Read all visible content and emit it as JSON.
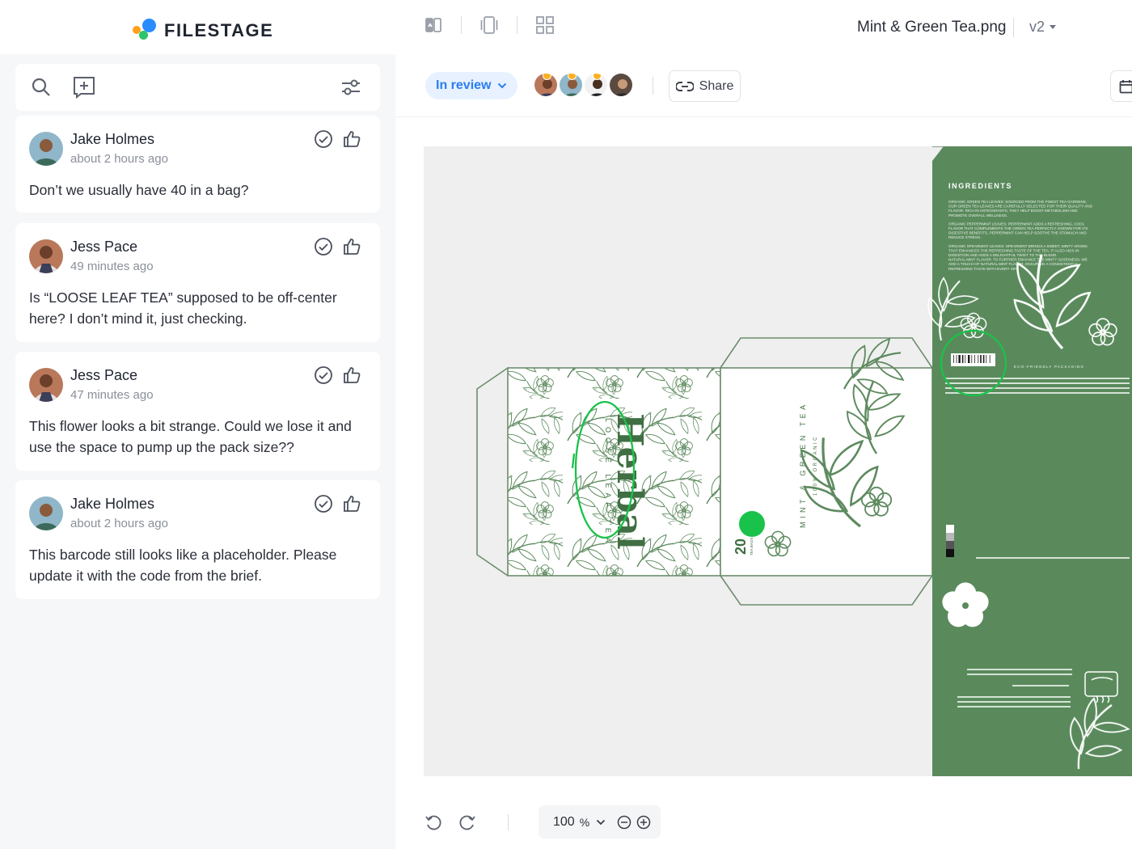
{
  "app": {
    "brand": "FILESTAGE",
    "file_title": "Mint & Green Tea.png",
    "version": "v2"
  },
  "colors": {
    "accent": "#2a7ef0",
    "status_bg": "#e7f1ff",
    "annotation_green": "#19c24a",
    "package_green": "#5a8a5c"
  },
  "review": {
    "status": "In review",
    "share_label": "Share"
  },
  "comments": [
    {
      "author": "Jake Holmes",
      "time": "about 2 hours ago",
      "text": "Don’t we usually have 40 in a bag?"
    },
    {
      "author": "Jess Pace",
      "time": "49 minutes ago",
      "text": "Is “LOOSE LEAF TEA” supposed to be off-center here? I don’t mind it, just checking."
    },
    {
      "author": "Jess Pace",
      "time": "47 minutes ago",
      "text": "This flower looks a bit strange. Could we lose it and use the space to pump up the pack size??"
    },
    {
      "author": "Jake Holmes",
      "time": "about 2 hours ago",
      "text": "This barcode still looks like a placeholder. Please update it with the code from the brief."
    }
  ],
  "artwork": {
    "brand_word": "Herbal",
    "subtitle": "LOOSE LEAF TEA",
    "side_title": "MINT & GREEN TEA",
    "side_sub": "100% ORGANIC",
    "count": "20",
    "count_unit": "TEA BAGS",
    "ingredients_heading": "INGREDIENTS",
    "ingredients_lines": [
      "ORGANIC GREEN TEA LEAVES: SOURCED FROM THE FINEST TEA GARDENS,",
      "OUR GREEN TEA LEAVES ARE CAREFULLY SELECTED FOR THEIR QUALITY AND",
      "FLAVOR. RICH IN ANTIOXIDANTS, THEY HELP BOOST METABOLISM AND",
      "PROMOTE OVERALL WELLNESS.",
      "ORGANIC PEPPERMINT LEAVES: PEPPERMINT ADDS A REFRESHING, COOL",
      "FLAVOR THAT COMPLEMENTS THE GREEN TEA PERFECTLY. KNOWN FOR ITS",
      "DIGESTIVE BENEFITS, PEPPERMINT CAN HELP SOOTHE THE STOMACH AND",
      "REDUCE STRESS.",
      "ORGANIC SPEARMINT LEAVES: SPEARMINT BRINGS A SWEET, MINTY AROMA",
      "THAT ENHANCES THE REFRESHING TASTE OF THE TEA. IT ALSO AIDS IN",
      "DIGESTION AND ADDS A DELIGHTFUL TWIST TO THE BLEND.",
      "NATURAL MINT FLAVOR: TO FURTHER ENHANCE THE MINTY GOODNESS, WE",
      "ADD A TOUCH OF NATURAL MINT FLAVOR, ENSURING A CONSISTENTLY",
      "REFRESHING TASTE WITH EVERY SIP."
    ],
    "eco_label": "ECO-FRIENDLY PACKAGING"
  },
  "zoom": {
    "value": "100",
    "unit": "%"
  }
}
